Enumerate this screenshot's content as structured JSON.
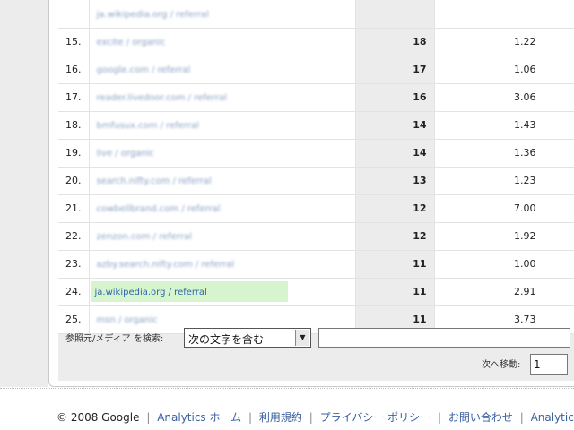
{
  "rows": [
    {
      "num": "",
      "source": "ja.wikipedia.org / referral",
      "value": "",
      "avg": ""
    },
    {
      "num": "15.",
      "source": "excite / organic",
      "value": "18",
      "avg": "1.22"
    },
    {
      "num": "16.",
      "source": "google.com / referral",
      "value": "17",
      "avg": "1.06"
    },
    {
      "num": "17.",
      "source": "reader.livedoor.com / referral",
      "value": "16",
      "avg": "3.06"
    },
    {
      "num": "18.",
      "source": "bmfusux.com / referral",
      "value": "14",
      "avg": "1.43"
    },
    {
      "num": "19.",
      "source": "live / organic",
      "value": "14",
      "avg": "1.36"
    },
    {
      "num": "20.",
      "source": "search.nifty.com / referral",
      "value": "13",
      "avg": "1.23"
    },
    {
      "num": "21.",
      "source": "cowbellbrand.com / referral",
      "value": "12",
      "avg": "7.00"
    },
    {
      "num": "22.",
      "source": "zenzon.com / referral",
      "value": "12",
      "avg": "1.92"
    },
    {
      "num": "23.",
      "source": "azby.search.nifty.com / referral",
      "value": "11",
      "avg": "1.00"
    },
    {
      "num": "24.",
      "source": "ja.wikipedia.org / referral",
      "value": "11",
      "avg": "2.91",
      "highlight": true
    },
    {
      "num": "25.",
      "source": "msn / organic",
      "value": "11",
      "avg": "3.73"
    }
  ],
  "search": {
    "label": "参照元/メディア を検索:",
    "dropdown_value": "次の文字を含む",
    "text_value": "",
    "goto_label": "次へ移動:",
    "goto_value": "1"
  },
  "footer": {
    "copyright": "© 2008 Google",
    "links": [
      "Analytics ホーム",
      "利用規約",
      "プライバシー ポリシー",
      "お問い合わせ",
      "Analytics ブ"
    ]
  },
  "colors": {
    "highlight_bg": "#d6f5cf",
    "link": "#3a5fa0",
    "panel_bg": "#ececec"
  }
}
